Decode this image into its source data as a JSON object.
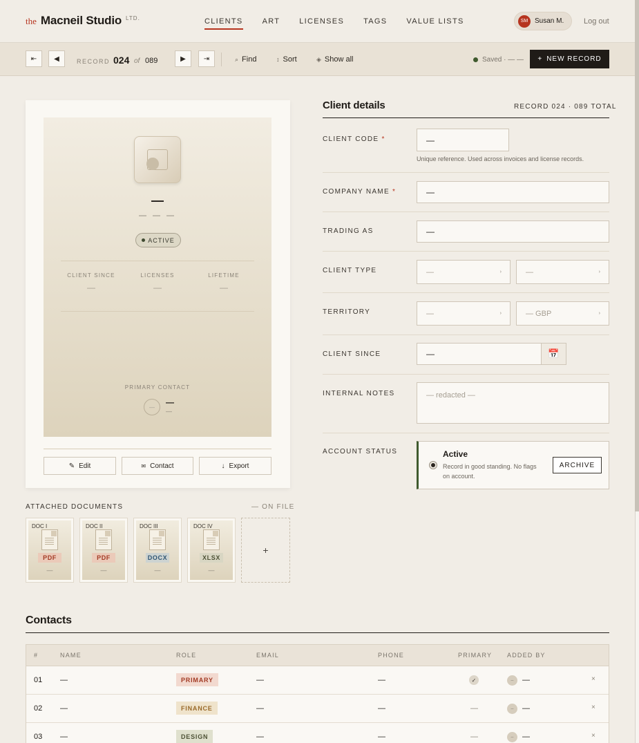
{
  "brand": {
    "prefix": "the",
    "name": "Macneil Studio",
    "suffix": "LTD."
  },
  "nav": [
    {
      "label": "CLIENTS",
      "active": true
    },
    {
      "label": "ART"
    },
    {
      "label": "LICENSES"
    },
    {
      "label": "TAGS"
    },
    {
      "label": "VALUE LISTS"
    }
  ],
  "user": {
    "initials": "SM",
    "name": "Susan M.",
    "logout": "Log out"
  },
  "toolbar": {
    "record_label": "RECORD",
    "record_current": "024",
    "record_of": "of",
    "record_total": "089",
    "find": "Find",
    "sort": "Sort",
    "show_all": "Show all",
    "saved": "Saved · — —",
    "new_record": "NEW RECORD"
  },
  "card": {
    "name": "—",
    "subtitle": "— — —",
    "status": "ACTIVE",
    "stats": [
      {
        "label": "CLIENT SINCE",
        "value": "—"
      },
      {
        "label": "LICENSES",
        "value": "—"
      },
      {
        "label": "LIFETIME",
        "value": "—"
      }
    ],
    "primary_contact_label": "PRIMARY CONTACT",
    "primary_contact_avatar": "—",
    "primary_contact_name": "—",
    "primary_contact_sub": "—",
    "buttons": {
      "edit": "Edit",
      "contact": "Contact",
      "export": "Export"
    }
  },
  "docs": {
    "heading": "ATTACHED DOCUMENTS",
    "on_file": "— ON FILE",
    "items": [
      {
        "label": "DOC I",
        "type": "PDF",
        "value": "—"
      },
      {
        "label": "DOC II",
        "type": "PDF",
        "value": "—"
      },
      {
        "label": "DOC III",
        "type": "DOCX",
        "value": "—"
      },
      {
        "label": "DOC IV",
        "type": "XLSX",
        "value": "—"
      }
    ],
    "add": "+"
  },
  "form": {
    "heading": "Client details",
    "record_info": "RECORD 024 · 089 TOTAL",
    "client_code": {
      "label": "CLIENT CODE",
      "value": "—",
      "hint": "Unique reference. Used across invoices and license records."
    },
    "company_name": {
      "label": "COMPANY NAME",
      "value": "—"
    },
    "trading_as": {
      "label": "TRADING AS",
      "value": "—"
    },
    "client_type": {
      "label": "CLIENT TYPE",
      "value1": "—",
      "value2": "—"
    },
    "territory": {
      "label": "TERRITORY",
      "value1": "—",
      "value2": "— GBP"
    },
    "client_since": {
      "label": "CLIENT SINCE",
      "value": "—"
    },
    "internal_notes": {
      "label": "INTERNAL NOTES",
      "value": "— redacted —"
    },
    "account_status": {
      "label": "ACCOUNT STATUS",
      "title": "Active",
      "desc": "Record in good standing. No flags on account.",
      "archive": "ARCHIVE"
    }
  },
  "contacts": {
    "heading": "Contacts",
    "columns": [
      "#",
      "NAME",
      "ROLE",
      "EMAIL",
      "PHONE",
      "PRIMARY",
      "ADDED BY"
    ],
    "rows": [
      {
        "num": "01",
        "name": "—",
        "role": "PRIMARY",
        "email": "—",
        "phone": "—",
        "primary": "✓",
        "added": "—"
      },
      {
        "num": "02",
        "name": "—",
        "role": "FINANCE",
        "email": "—",
        "phone": "—",
        "primary": "—",
        "added": "—"
      },
      {
        "num": "03",
        "name": "—",
        "role": "DESIGN",
        "email": "—",
        "phone": "—",
        "primary": "—",
        "added": "—"
      }
    ]
  },
  "colors": {
    "accent": "#b6341f",
    "dark": "#1f1b17",
    "status_green": "#3f5a2e"
  }
}
